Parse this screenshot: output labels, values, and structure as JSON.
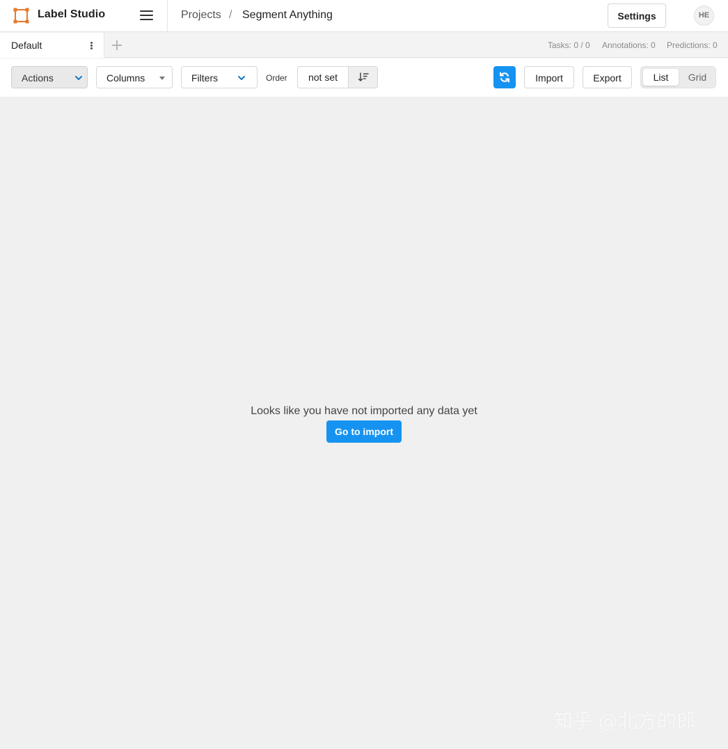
{
  "app": {
    "title": "Label Studio",
    "brand_color": "#e8792b"
  },
  "breadcrumb": {
    "projects": "Projects",
    "separator": "/",
    "current": "Segment Anything"
  },
  "header": {
    "settings_label": "Settings",
    "avatar_initials": "HE"
  },
  "tabs": {
    "items": [
      {
        "label": "Default",
        "active": true
      }
    ]
  },
  "stats": {
    "tasks": "Tasks: 0 / 0",
    "annotations": "Annotations: 0",
    "predictions": "Predictions: 0"
  },
  "toolbar": {
    "actions_label": "Actions",
    "columns_label": "Columns",
    "filters_label": "Filters",
    "order_label": "Order",
    "order_value": "not set",
    "import_label": "Import",
    "export_label": "Export",
    "view_list_label": "List",
    "view_grid_label": "Grid",
    "active_view": "List",
    "accent_color": "#1693f0"
  },
  "main": {
    "empty_message": "Looks like you have not imported any data yet",
    "goto_import_label": "Go to import"
  },
  "watermark": {
    "text": "知乎 @北方的郎"
  }
}
